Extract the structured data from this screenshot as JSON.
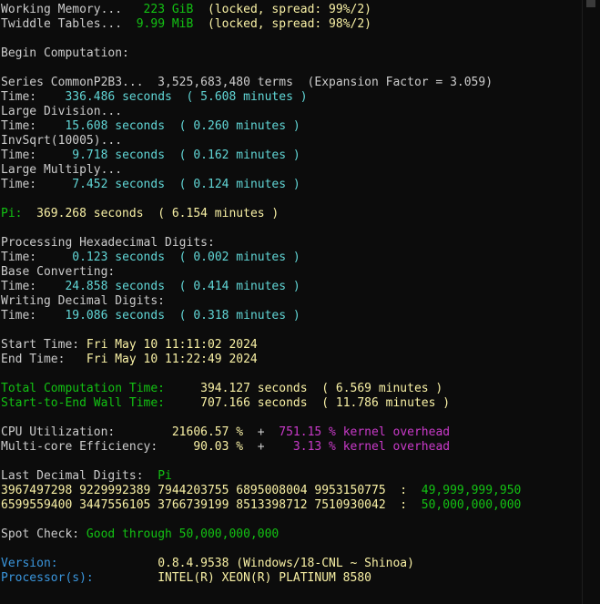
{
  "lines": [
    [
      {
        "t": "                   )",
        "c": "w"
      }
    ],
    [
      {
        "t": "Working Memory...   ",
        "c": "w"
      },
      {
        "t": "223 GiB",
        "c": "g"
      },
      {
        "t": "  (locked, spread: 99%/2)",
        "c": "y"
      }
    ],
    [
      {
        "t": "Twiddle Tables...  ",
        "c": "w"
      },
      {
        "t": "9.99 MiB",
        "c": "g"
      },
      {
        "t": "  (locked, spread: 98%/2)",
        "c": "y"
      }
    ],
    [],
    [
      {
        "t": "Begin Computation:",
        "c": "w"
      }
    ],
    [],
    [
      {
        "t": "Series CommonP2B3...  3,525,683,480 terms  (Expansion Factor = 3.059)",
        "c": "w"
      }
    ],
    [
      {
        "t": "Time:    ",
        "c": "w"
      },
      {
        "t": "336.486 seconds  ( 5.608 minutes )",
        "c": "t"
      }
    ],
    [
      {
        "t": "Large Division...",
        "c": "w"
      }
    ],
    [
      {
        "t": "Time:    ",
        "c": "w"
      },
      {
        "t": "15.608 seconds  ( 0.260 minutes )",
        "c": "t"
      }
    ],
    [
      {
        "t": "InvSqrt(10005)...",
        "c": "w"
      }
    ],
    [
      {
        "t": "Time:     ",
        "c": "w"
      },
      {
        "t": "9.718 seconds  ( 0.162 minutes )",
        "c": "t"
      }
    ],
    [
      {
        "t": "Large Multiply...",
        "c": "w"
      }
    ],
    [
      {
        "t": "Time:     ",
        "c": "w"
      },
      {
        "t": "7.452 seconds  ( 0.124 minutes )",
        "c": "t"
      }
    ],
    [],
    [
      {
        "t": "Pi:  ",
        "c": "g"
      },
      {
        "t": "369.268 seconds  ( 6.154 minutes )",
        "c": "y"
      }
    ],
    [],
    [
      {
        "t": "Processing Hexadecimal Digits:",
        "c": "w"
      }
    ],
    [
      {
        "t": "Time:     ",
        "c": "w"
      },
      {
        "t": "0.123 seconds  ( 0.002 minutes )",
        "c": "t"
      }
    ],
    [
      {
        "t": "Base Converting:",
        "c": "w"
      }
    ],
    [
      {
        "t": "Time:    ",
        "c": "w"
      },
      {
        "t": "24.858 seconds  ( 0.414 minutes )",
        "c": "t"
      }
    ],
    [
      {
        "t": "Writing Decimal Digits:",
        "c": "w"
      }
    ],
    [
      {
        "t": "Time:    ",
        "c": "w"
      },
      {
        "t": "19.086 seconds  ( 0.318 minutes )",
        "c": "t"
      }
    ],
    [],
    [
      {
        "t": "Start Time: ",
        "c": "w"
      },
      {
        "t": "Fri May 10 11:11:02 2024",
        "c": "y"
      }
    ],
    [
      {
        "t": "End Time:   ",
        "c": "w"
      },
      {
        "t": "Fri May 10 11:22:49 2024",
        "c": "y"
      }
    ],
    [],
    [
      {
        "t": "Total Computation Time:     ",
        "c": "g"
      },
      {
        "t": "394.127 seconds  ( 6.569 minutes )",
        "c": "y"
      }
    ],
    [
      {
        "t": "Start-to-End Wall Time:     ",
        "c": "g"
      },
      {
        "t": "707.166 seconds  ( 11.786 minutes )",
        "c": "y"
      }
    ],
    [],
    [
      {
        "t": "CPU Utilization:        ",
        "c": "w"
      },
      {
        "t": "21606.57 %",
        "c": "y"
      },
      {
        "t": "  +  ",
        "c": "w"
      },
      {
        "t": "751.15 % kernel overhead",
        "c": "m"
      }
    ],
    [
      {
        "t": "Multi-core Efficiency:     ",
        "c": "w"
      },
      {
        "t": "90.03 %",
        "c": "y"
      },
      {
        "t": "  +    ",
        "c": "w"
      },
      {
        "t": "3.13 % kernel overhead",
        "c": "m"
      }
    ],
    [],
    [
      {
        "t": "Last Decimal Digits:  ",
        "c": "w"
      },
      {
        "t": "Pi",
        "c": "g"
      }
    ],
    [
      {
        "t": "3967497298 9229992389 7944203755 6895008004 9953150775  :  ",
        "c": "y"
      },
      {
        "t": "49,999,999,950",
        "c": "g"
      }
    ],
    [
      {
        "t": "6599559400 3447556105 3766739199 8513398712 7510930042  :  ",
        "c": "y"
      },
      {
        "t": "50,000,000,000",
        "c": "g"
      }
    ],
    [],
    [
      {
        "t": "Spot Check: ",
        "c": "w"
      },
      {
        "t": "Good through 50,000,000,000",
        "c": "g"
      }
    ],
    [],
    [
      {
        "t": "Version:              ",
        "c": "c"
      },
      {
        "t": "0.8.4.9538 (Windows/18-CNL ~ Shinoa)",
        "c": "y"
      }
    ],
    [
      {
        "t": "Processor(s):         ",
        "c": "c"
      },
      {
        "t": "INTEL(R) XEON(R) PLATINUM 8580",
        "c": "y"
      }
    ]
  ]
}
